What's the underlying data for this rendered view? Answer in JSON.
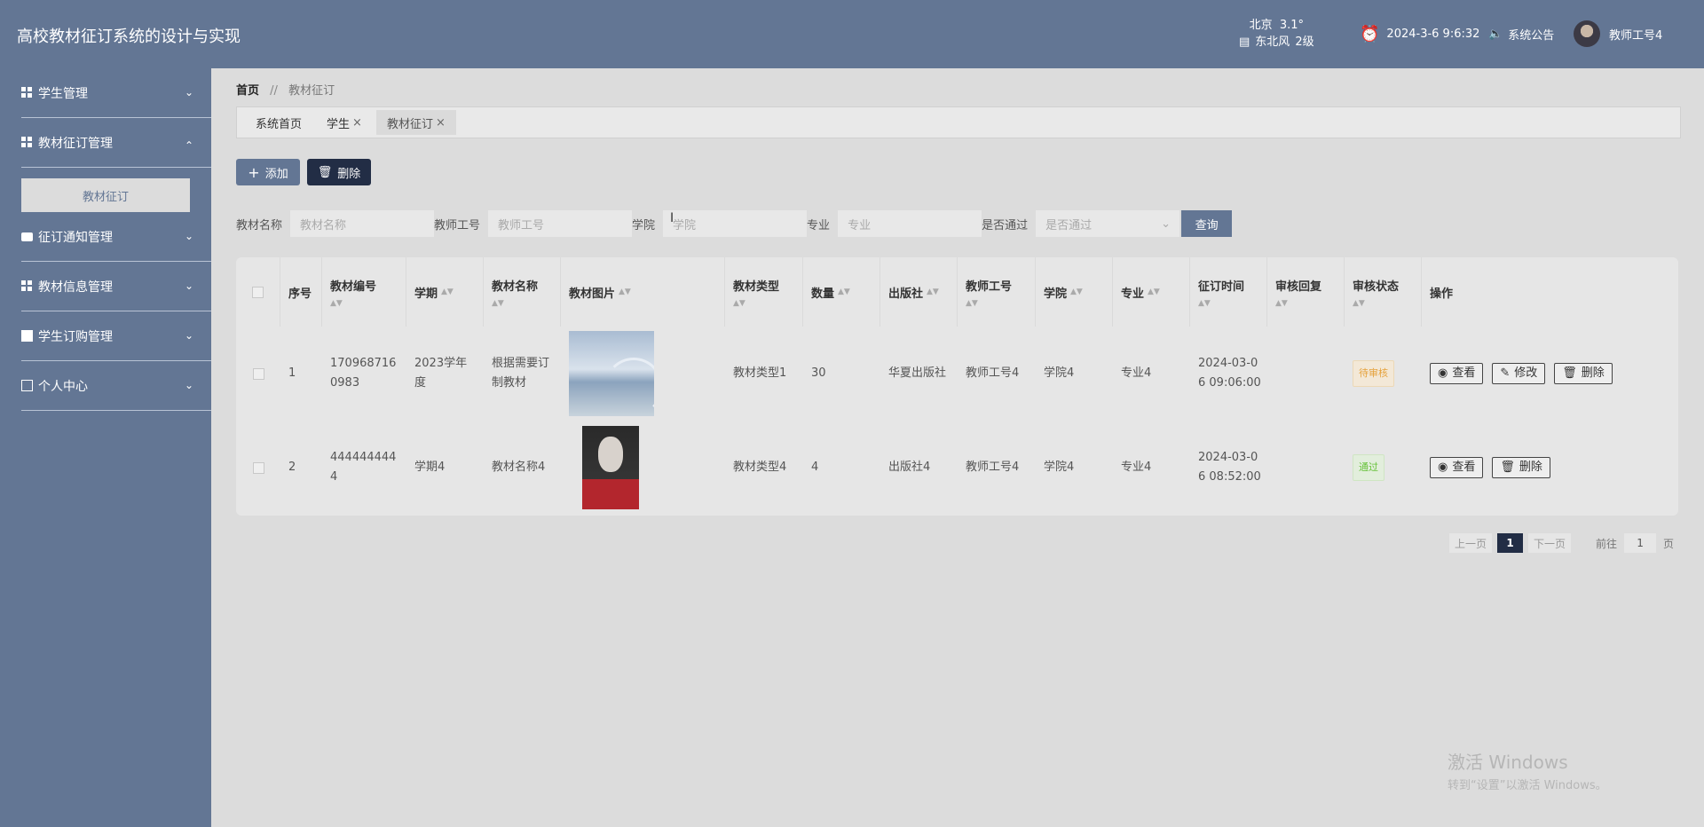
{
  "header": {
    "title": "高校教材征订系统的设计与实现",
    "weather_city": "北京",
    "weather_temp": "3.1°",
    "weather_wind": "东北风",
    "weather_level": "2级",
    "datetime": "2024-3-6 9:6:32",
    "notice": "系统公告",
    "username": "教师工号4"
  },
  "sidebar": {
    "items": [
      {
        "label": "学生管理",
        "expanded": false
      },
      {
        "label": "教材征订管理",
        "expanded": true,
        "children": [
          "教材征订"
        ]
      },
      {
        "label": "征订通知管理",
        "expanded": false
      },
      {
        "label": "教材信息管理",
        "expanded": false
      },
      {
        "label": "学生订购管理",
        "expanded": false
      },
      {
        "label": "个人中心",
        "expanded": false
      }
    ]
  },
  "breadcrumb": {
    "home": "首页",
    "sep": "//",
    "current": "教材征订"
  },
  "tabs": [
    {
      "label": "系统首页",
      "closable": false
    },
    {
      "label": "学生",
      "closable": true
    },
    {
      "label": "教材征订",
      "closable": true,
      "active": true
    }
  ],
  "toolbar": {
    "add": "添加",
    "delete": "删除"
  },
  "search": {
    "book_name_label": "教材名称",
    "book_name_ph": "教材名称",
    "teacher_label": "教师工号",
    "teacher_ph": "教师工号",
    "college_label": "学院",
    "college_ph": "学院",
    "major_label": "专业",
    "major_ph": "专业",
    "pass_label": "是否通过",
    "pass_ph": "是否通过",
    "query": "查询"
  },
  "table": {
    "headers": [
      "序号",
      "教材编号",
      "学期",
      "教材名称",
      "教材图片",
      "教材类型",
      "数量",
      "出版社",
      "教师工号",
      "学院",
      "专业",
      "征订时间",
      "审核回复",
      "审核状态",
      "操作"
    ],
    "rows": [
      {
        "index": "1",
        "code_a": "170968716",
        "code_b": "0983",
        "term_a": "2023学年",
        "term_b": "度",
        "name_a": "根据需要订",
        "name_b": "制教材",
        "type": "教材类型1",
        "qty": "30",
        "publisher": "华夏出版社",
        "teacher": "教师工号4",
        "college": "学院4",
        "major": "专业4",
        "time_a": "2024-03-0",
        "time_b": "6 09:06:00",
        "reply": "",
        "status": "待审核",
        "ops": [
          "查看",
          "修改",
          "删除"
        ]
      },
      {
        "index": "2",
        "code_a": "444444444",
        "code_b": "4",
        "term": "学期4",
        "name": "教材名称4",
        "type": "教材类型4",
        "qty": "4",
        "publisher": "出版社4",
        "teacher": "教师工号4",
        "college": "学院4",
        "major": "专业4",
        "time_a": "2024-03-0",
        "time_b": "6 08:52:00",
        "reply": "",
        "status": "通过",
        "ops": [
          "查看",
          "删除"
        ]
      }
    ]
  },
  "pager": {
    "prev": "上一页",
    "current": "1",
    "next": "下一页",
    "goto_pre": "前往",
    "goto_val": "1",
    "goto_post": "页"
  },
  "watermark": {
    "line1": "激活 Windows",
    "line2": "转到“设置”以激活 Windows。"
  },
  "colors": {
    "primary": "#637694",
    "dark": "#222d45",
    "bg": "#dcdcdc",
    "pending": "#e6a23c",
    "pass": "#67c23a"
  }
}
